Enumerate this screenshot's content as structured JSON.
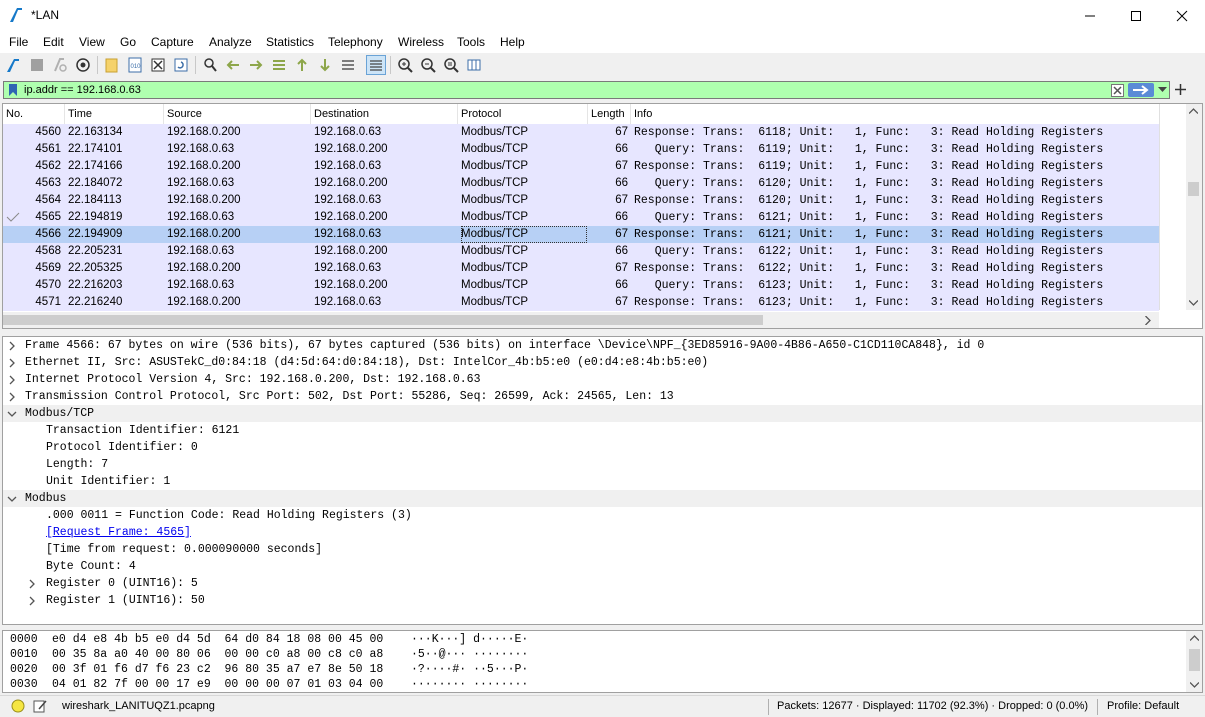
{
  "window": {
    "title": "*LAN"
  },
  "menu": [
    "File",
    "Edit",
    "View",
    "Go",
    "Capture",
    "Analyze",
    "Statistics",
    "Telephony",
    "Wireless",
    "Tools",
    "Help"
  ],
  "filter": {
    "value": "ip.addr == 192.168.0.63",
    "bg_color": "#afffaf"
  },
  "packet_list": {
    "columns": [
      "No.",
      "Time",
      "Source",
      "Destination",
      "Protocol",
      "Length",
      "Info"
    ],
    "rows": [
      {
        "no": "4560",
        "time": "22.163134",
        "src": "192.168.0.200",
        "dst": "192.168.0.63",
        "proto": "Modbus/TCP",
        "len": "67",
        "info": "Response: Trans:  6118; Unit:   1, Func:   3: Read Holding Registers"
      },
      {
        "no": "4561",
        "time": "22.174101",
        "src": "192.168.0.63",
        "dst": "192.168.0.200",
        "proto": "Modbus/TCP",
        "len": "66",
        "info": "   Query: Trans:  6119; Unit:   1, Func:   3: Read Holding Registers"
      },
      {
        "no": "4562",
        "time": "22.174166",
        "src": "192.168.0.200",
        "dst": "192.168.0.63",
        "proto": "Modbus/TCP",
        "len": "67",
        "info": "Response: Trans:  6119; Unit:   1, Func:   3: Read Holding Registers"
      },
      {
        "no": "4563",
        "time": "22.184072",
        "src": "192.168.0.63",
        "dst": "192.168.0.200",
        "proto": "Modbus/TCP",
        "len": "66",
        "info": "   Query: Trans:  6120; Unit:   1, Func:   3: Read Holding Registers"
      },
      {
        "no": "4564",
        "time": "22.184113",
        "src": "192.168.0.200",
        "dst": "192.168.0.63",
        "proto": "Modbus/TCP",
        "len": "67",
        "info": "Response: Trans:  6120; Unit:   1, Func:   3: Read Holding Registers"
      },
      {
        "no": "4565",
        "time": "22.194819",
        "src": "192.168.0.63",
        "dst": "192.168.0.200",
        "proto": "Modbus/TCP",
        "len": "66",
        "info": "   Query: Trans:  6121; Unit:   1, Func:   3: Read Holding Registers"
      },
      {
        "no": "4566",
        "time": "22.194909",
        "src": "192.168.0.200",
        "dst": "192.168.0.63",
        "proto": "Modbus/TCP",
        "len": "67",
        "info": "Response: Trans:  6121; Unit:   1, Func:   3: Read Holding Registers",
        "selected": true
      },
      {
        "no": "4568",
        "time": "22.205231",
        "src": "192.168.0.63",
        "dst": "192.168.0.200",
        "proto": "Modbus/TCP",
        "len": "66",
        "info": "   Query: Trans:  6122; Unit:   1, Func:   3: Read Holding Registers"
      },
      {
        "no": "4569",
        "time": "22.205325",
        "src": "192.168.0.200",
        "dst": "192.168.0.63",
        "proto": "Modbus/TCP",
        "len": "67",
        "info": "Response: Trans:  6122; Unit:   1, Func:   3: Read Holding Registers"
      },
      {
        "no": "4570",
        "time": "22.216203",
        "src": "192.168.0.63",
        "dst": "192.168.0.200",
        "proto": "Modbus/TCP",
        "len": "66",
        "info": "   Query: Trans:  6123; Unit:   1, Func:   3: Read Holding Registers"
      },
      {
        "no": "4571",
        "time": "22.216240",
        "src": "192.168.0.200",
        "dst": "192.168.0.63",
        "proto": "Modbus/TCP",
        "len": "67",
        "info": "Response: Trans:  6123; Unit:   1, Func:   3: Read Holding Registers"
      }
    ],
    "row_color": "#e7e6ff",
    "selected_color": "#b7d0f5"
  },
  "details": [
    {
      "text": "Frame 4566: 67 bytes on wire (536 bits), 67 bytes captured (536 bits) on interface \\Device\\NPF_{3ED85916-9A00-4B86-A650-C1CD110CA848}, id 0",
      "level": 0,
      "expander": "collapsed"
    },
    {
      "text": "Ethernet II, Src: ASUSTekC_d0:84:18 (d4:5d:64:d0:84:18), Dst: IntelCor_4b:b5:e0 (e0:d4:e8:4b:b5:e0)",
      "level": 0,
      "expander": "collapsed"
    },
    {
      "text": "Internet Protocol Version 4, Src: 192.168.0.200, Dst: 192.168.0.63",
      "level": 0,
      "expander": "collapsed"
    },
    {
      "text": "Transmission Control Protocol, Src Port: 502, Dst Port: 55286, Seq: 26599, Ack: 24565, Len: 13",
      "level": 0,
      "expander": "collapsed"
    },
    {
      "text": "Modbus/TCP",
      "level": 0,
      "expander": "expanded"
    },
    {
      "text": "Transaction Identifier: 6121",
      "level": 1,
      "expander": "none"
    },
    {
      "text": "Protocol Identifier: 0",
      "level": 1,
      "expander": "none"
    },
    {
      "text": "Length: 7",
      "level": 1,
      "expander": "none"
    },
    {
      "text": "Unit Identifier: 1",
      "level": 1,
      "expander": "none"
    },
    {
      "text": "Modbus",
      "level": 0,
      "expander": "expanded"
    },
    {
      "text": ".000 0011 = Function Code: Read Holding Registers (3)",
      "level": 1,
      "expander": "none"
    },
    {
      "text": "[Request Frame: 4565]",
      "level": 1,
      "expander": "none",
      "link": true
    },
    {
      "text": "[Time from request: 0.000090000 seconds]",
      "level": 1,
      "expander": "none"
    },
    {
      "text": "Byte Count: 4",
      "level": 1,
      "expander": "none"
    },
    {
      "text": "Register 0 (UINT16): 5",
      "level": 1,
      "expander": "collapsed"
    },
    {
      "text": "Register 1 (UINT16): 50",
      "level": 1,
      "expander": "collapsed"
    }
  ],
  "bytes": [
    {
      "offset": "0000",
      "hex": "e0 d4 e8 4b b5 e0 d4 5d  64 d0 84 18 08 00 45 00",
      "ascii": "···K···] d·····E·"
    },
    {
      "offset": "0010",
      "hex": "00 35 8a a0 40 00 80 06  00 00 c0 a8 00 c8 c0 a8",
      "ascii": "·5··@··· ········"
    },
    {
      "offset": "0020",
      "hex": "00 3f 01 f6 d7 f6 23 c2  96 80 35 a7 e7 8e 50 18",
      "ascii": "·?····#· ··5···P·"
    },
    {
      "offset": "0030",
      "hex": "04 01 82 7f 00 00 17 e9  00 00 00 07 01 03 04 00",
      "ascii": "········ ········"
    }
  ],
  "status": {
    "file": "wireshark_LANITUQZ1.pcapng",
    "packets": "Packets: 12677 · Displayed: 11702 (92.3%) · Dropped: 0 (0.0%)",
    "profile": "Profile: Default"
  }
}
